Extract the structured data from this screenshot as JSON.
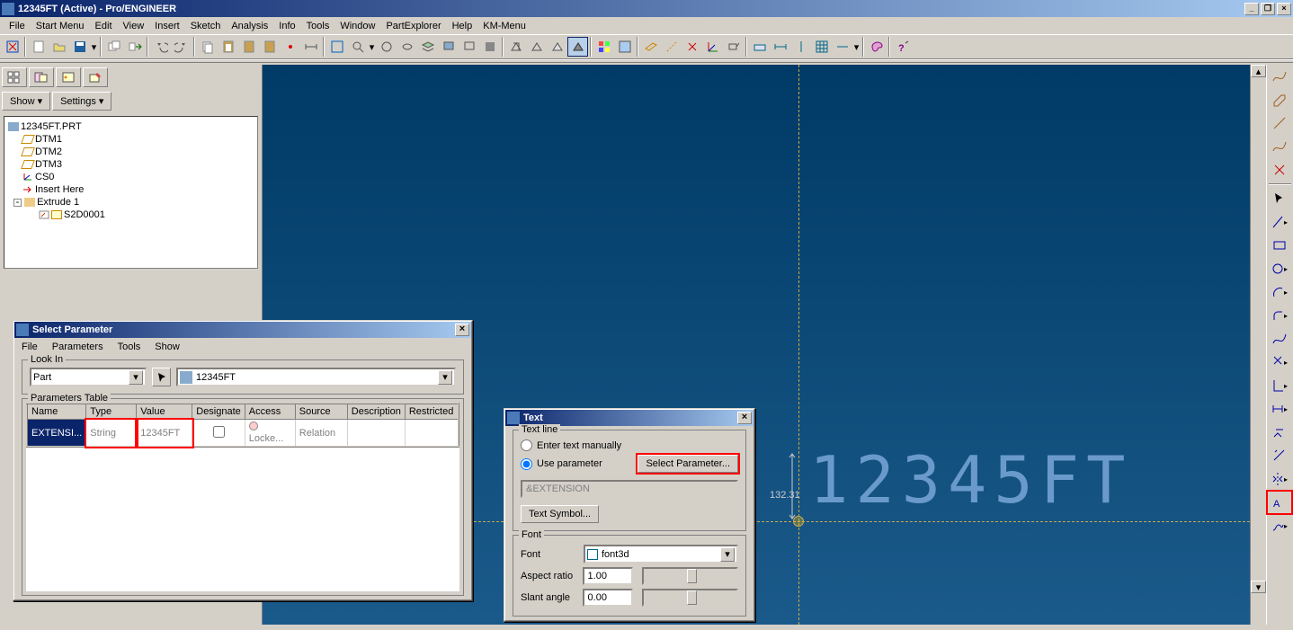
{
  "window": {
    "title": "12345FT (Active) - Pro/ENGINEER"
  },
  "menus": [
    "File",
    "Start Menu",
    "Edit",
    "View",
    "Insert",
    "Sketch",
    "Analysis",
    "Info",
    "Tools",
    "Window",
    "PartExplorer",
    "Help",
    "KM-Menu"
  ],
  "leftpanel": {
    "show_label": "Show ▾",
    "settings_label": "Settings ▾",
    "root": "12345FT.PRT",
    "nodes": [
      "DTM1",
      "DTM2",
      "DTM3",
      "CS0",
      "Insert Here",
      "Extrude 1",
      "S2D0001"
    ],
    "selected": "DTM2"
  },
  "select_param_dialog": {
    "title": "Select Parameter",
    "menus": [
      "File",
      "Parameters",
      "Tools",
      "Show"
    ],
    "lookin_label": "Look In",
    "lookin_type": "Part",
    "lookin_name": "12345FT",
    "params_table_label": "Parameters Table",
    "headers": [
      "Name",
      "Type",
      "Value",
      "Designate",
      "Access",
      "Source",
      "Description",
      "Restricted"
    ],
    "row": {
      "name": "EXTENSI...",
      "type": "String",
      "value": "12345FT",
      "designate": "",
      "access": "Locke...",
      "source": "Relation",
      "description": "",
      "restricted": ""
    }
  },
  "text_dialog": {
    "title": "Text",
    "textline_label": "Text line",
    "opt_manual": "Enter text manually",
    "opt_param": "Use parameter",
    "select_param_btn": "Select Parameter...",
    "param_value": "&EXTENSION",
    "text_symbol_btn": "Text Symbol...",
    "font_label": "Font",
    "font_field_label": "Font",
    "font_value": "font3d",
    "aspect_label": "Aspect ratio",
    "aspect_value": "1.00",
    "slant_label": "Slant angle",
    "slant_value": "0.00"
  },
  "viewport": {
    "text": "12345FT",
    "dim": "132.31"
  }
}
